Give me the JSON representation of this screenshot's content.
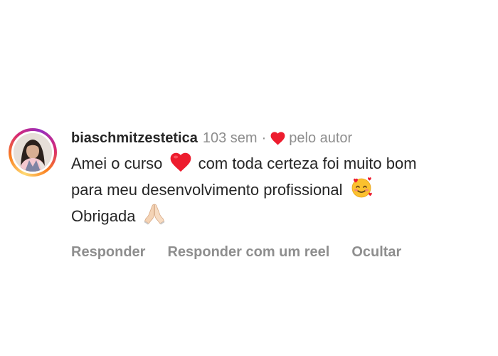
{
  "comment": {
    "username": "biaschmitzestetica",
    "time": "103 sem",
    "separator": "·",
    "liked_by_author_label": "pelo autor",
    "text_line1_a": "Amei o curso",
    "text_line1_b": "com toda certeza foi muito bom",
    "text_line2": "para meu desenvolvimento profissional",
    "text_line3": "Obrigada",
    "emojis": [
      "red-heart",
      "smiling-face-with-hearts",
      "folded-hands"
    ]
  },
  "actions": {
    "reply": "Responder",
    "reply_reel": "Responder com um reel",
    "hide": "Ocultar"
  },
  "colors": {
    "heart": "#ed1c2e",
    "text": "#262626",
    "secondary": "#8e8e8e"
  }
}
